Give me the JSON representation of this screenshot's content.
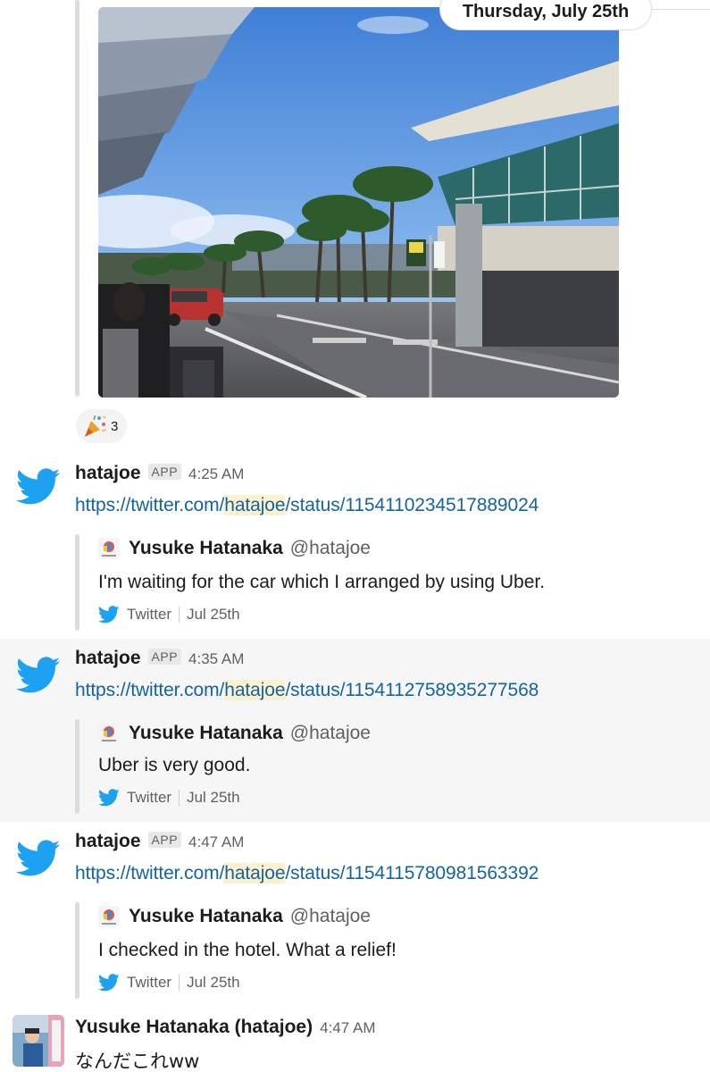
{
  "date_divider": {
    "label": "Thursday, July 25th"
  },
  "photo_attachment": {
    "alt": ""
  },
  "reaction": {
    "emoji": "tada",
    "count": "3"
  },
  "messages": [
    {
      "sender": "hatajoe",
      "badge": "APP",
      "time": "4:25 AM",
      "link_prefix": "https://twitter.com/",
      "link_highlight": "hatajoe",
      "link_suffix": "/status/1154110234517889024",
      "unfurl": {
        "author": "Yusuke Hatanaka",
        "handle": "@hatajoe",
        "text": "I'm waiting for the car which I arranged by using Uber.",
        "source": "Twitter",
        "date": "Jul 25th"
      }
    },
    {
      "sender": "hatajoe",
      "badge": "APP",
      "time": "4:35 AM",
      "link_prefix": "https://twitter.com/",
      "link_highlight": "hatajoe",
      "link_suffix": "/status/1154112758935277568",
      "unfurl": {
        "author": "Yusuke Hatanaka",
        "handle": "@hatajoe",
        "text": "Uber is very good.",
        "source": "Twitter",
        "date": "Jul 25th"
      }
    },
    {
      "sender": "hatajoe",
      "badge": "APP",
      "time": "4:47 AM",
      "link_prefix": "https://twitter.com/",
      "link_highlight": "hatajoe",
      "link_suffix": "/status/1154115780981563392",
      "unfurl": {
        "author": "Yusuke Hatanaka",
        "handle": "@hatajoe",
        "text": "I checked in the hotel. What a relief!",
        "source": "Twitter",
        "date": "Jul 25th"
      }
    }
  ],
  "user_message": {
    "sender": "Yusuke Hatanaka (hatajoe)",
    "time": "4:47 AM",
    "text": "なんだこれww"
  },
  "colors": {
    "link": "#1264a3",
    "twitter_blue": "#1da1f2",
    "highlight": "#fcf1cf",
    "hover_row": "#f6f6f6"
  }
}
